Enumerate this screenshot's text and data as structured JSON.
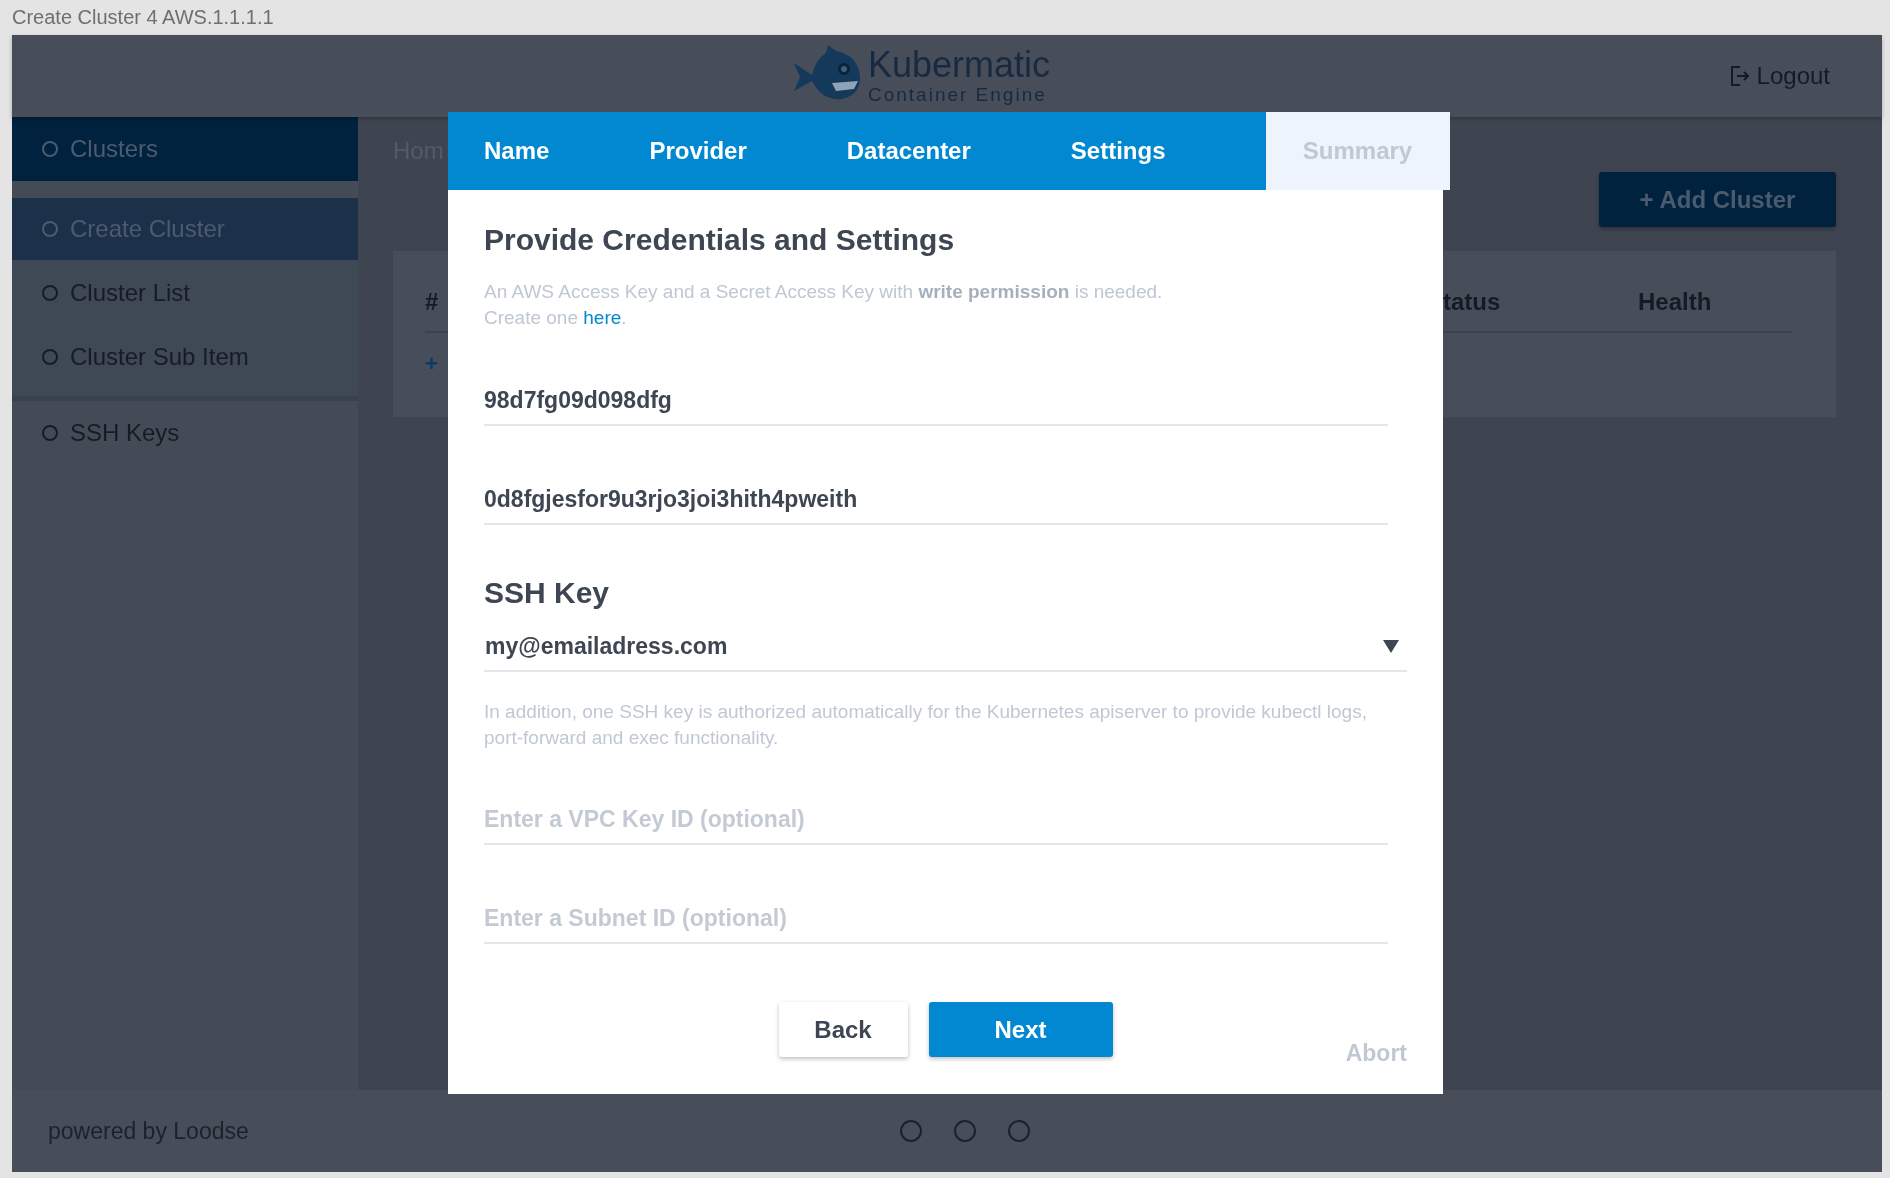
{
  "window": {
    "title": "Create Cluster 4 AWS.1.1.1.1"
  },
  "header": {
    "logo": {
      "name": "Kubermatic",
      "tagline": "Container Engine"
    },
    "logout": "Logout"
  },
  "sidebar": {
    "items": [
      {
        "label": "Clusters",
        "selected": true,
        "children": [
          {
            "label": "Create Cluster",
            "selected": true
          },
          {
            "label": "Cluster List",
            "selected": false
          },
          {
            "label": "Cluster Sub Item",
            "selected": false
          }
        ]
      },
      {
        "label": "SSH Keys",
        "selected": false
      }
    ]
  },
  "main": {
    "breadcrumb": "Hom",
    "add_button": "+ Add Cluster",
    "table": {
      "columns": [
        "#",
        "tatus",
        "Health"
      ],
      "add_link": "+"
    }
  },
  "dialog": {
    "tabs": [
      {
        "label": "Name",
        "disabled": false
      },
      {
        "label": "Provider",
        "disabled": false
      },
      {
        "label": "Datacenter",
        "disabled": false
      },
      {
        "label": "Settings",
        "disabled": false
      },
      {
        "label": "Summary",
        "disabled": true
      }
    ],
    "heading": "Provide Credentials and Settings",
    "description": "An AWS Access Key and a Secret Access Key with **write permission** is needed.",
    "create_hint": {
      "text": "Create one ",
      "link": "here",
      "suffix": "."
    },
    "credentials": [
      {
        "value": "98d7fg09d098dfg"
      },
      {
        "value": "0d8fgjesfor9u3rjo3joi3hith4pweith"
      }
    ],
    "ssh_key": {
      "heading": "SSH Key",
      "value": "my@emailadress.com",
      "hint": "In addition, one SSH key is authorized automatically for the Kubernetes apiserver to provide kubectl logs, port-forward and exec functionality."
    },
    "optional_fields": [
      {
        "placeholder": "Enter a VPC Key ID (optional)"
      },
      {
        "placeholder": "Enter a Subnet ID (optional)"
      }
    ],
    "buttons": {
      "back": "Back",
      "next": "Next",
      "abort": "Abort"
    }
  },
  "footer": {
    "text": "powered by Loodse",
    "pager": [
      {
        "selected": false
      },
      {
        "selected": false
      },
      {
        "selected": false
      }
    ]
  }
}
